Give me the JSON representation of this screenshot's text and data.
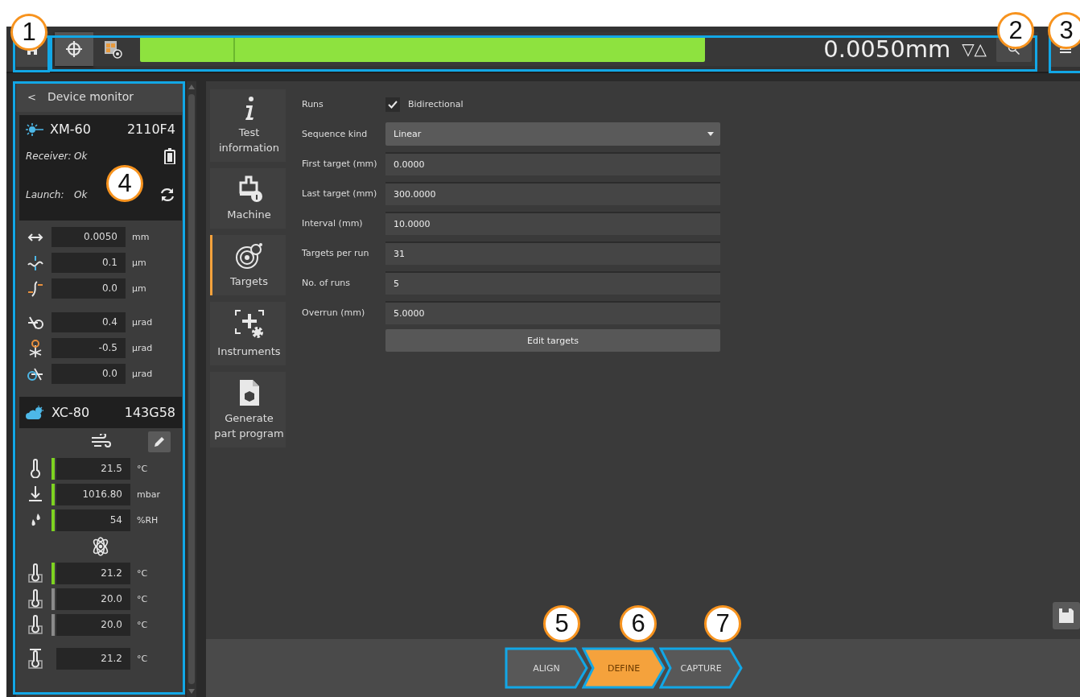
{
  "toolbar": {
    "mode_buttons": [
      {
        "kind": "crosshair",
        "selected": true
      },
      {
        "kind": "grid",
        "selected": false
      }
    ],
    "reading": "0.0050mm",
    "step_arrows": "▽△"
  },
  "device_monitor": {
    "title": "Device monitor",
    "back": "<",
    "laser": {
      "name": "XM-60",
      "serial": "2110F4",
      "status": [
        {
          "kind": "receiver",
          "label": "Receiver:",
          "value": "Ok"
        },
        {
          "kind": "launch",
          "label": "Launch:",
          "value": "Ok"
        }
      ],
      "reading_groups": [
        [
          {
            "kind": "linear",
            "value": "0.0050",
            "unit": "mm"
          },
          {
            "kind": "vertical",
            "value": "0.1",
            "unit": "µm"
          },
          {
            "kind": "horizontal",
            "value": "0.0",
            "unit": "µm"
          }
        ],
        [
          {
            "kind": "pitch",
            "value": "0.4",
            "unit": "µrad"
          },
          {
            "kind": "yaw",
            "value": "-0.5",
            "unit": "µrad"
          },
          {
            "kind": "roll",
            "value": "0.0",
            "unit": "µrad"
          }
        ]
      ]
    },
    "environment": {
      "name": "XC-80",
      "serial": "143G58",
      "air": [
        {
          "kind": "air_temp",
          "value": "21.5",
          "unit": "°C",
          "color": "#7ed321"
        },
        {
          "kind": "pressure",
          "value": "1016.80",
          "unit": "mbar",
          "color": "#7ed321"
        },
        {
          "kind": "humidity",
          "value": "54",
          "unit": "%RH",
          "color": "#7ed321"
        }
      ],
      "material": [
        {
          "kind": "material_temp",
          "value": "21.2",
          "unit": "°C",
          "color": "#7ed321"
        },
        {
          "kind": "material_temp",
          "value": "20.0",
          "unit": "°C",
          "color": "#8a8a8a"
        },
        {
          "kind": "material_temp",
          "value": "20.0",
          "unit": "°C",
          "color": "#8a8a8a"
        }
      ],
      "average": {
        "kind": "average_temp",
        "value": "21.2",
        "unit": "°C"
      }
    }
  },
  "side_tabs": [
    {
      "kind": "info",
      "label": "Test information",
      "selected": false
    },
    {
      "kind": "machine",
      "label": "Machine",
      "selected": false
    },
    {
      "kind": "targets",
      "label": "Targets",
      "selected": true
    },
    {
      "kind": "instruments",
      "label": "Instruments",
      "selected": false
    },
    {
      "kind": "document",
      "label": "Generate part program",
      "selected": false
    }
  ],
  "form": {
    "fields": [
      {
        "kind": "checkbox",
        "label": "Runs",
        "text": "Bidirectional",
        "checked": true
      },
      {
        "kind": "dropdown",
        "label": "Sequence kind",
        "value": "Linear"
      },
      {
        "kind": "text",
        "label": "First target (mm)",
        "value": "0.0000"
      },
      {
        "kind": "text",
        "label": "Last target (mm)",
        "value": "300.0000"
      },
      {
        "kind": "text",
        "label": "Interval (mm)",
        "value": "10.0000"
      },
      {
        "kind": "text",
        "label": "Targets per run",
        "value": "31"
      },
      {
        "kind": "text",
        "label": "No. of runs",
        "value": "5"
      },
      {
        "kind": "text",
        "label": "Overrun (mm)",
        "value": "5.0000"
      }
    ],
    "edit_button": "Edit targets"
  },
  "steps": [
    {
      "label": "ALIGN",
      "selected": false
    },
    {
      "label": "DEFINE",
      "selected": true
    },
    {
      "label": "CAPTURE",
      "selected": false
    }
  ],
  "callouts": [
    {
      "number": "1"
    },
    {
      "number": "2"
    },
    {
      "number": "3"
    },
    {
      "number": "4"
    },
    {
      "number": "5"
    },
    {
      "number": "6"
    },
    {
      "number": "7"
    }
  ]
}
